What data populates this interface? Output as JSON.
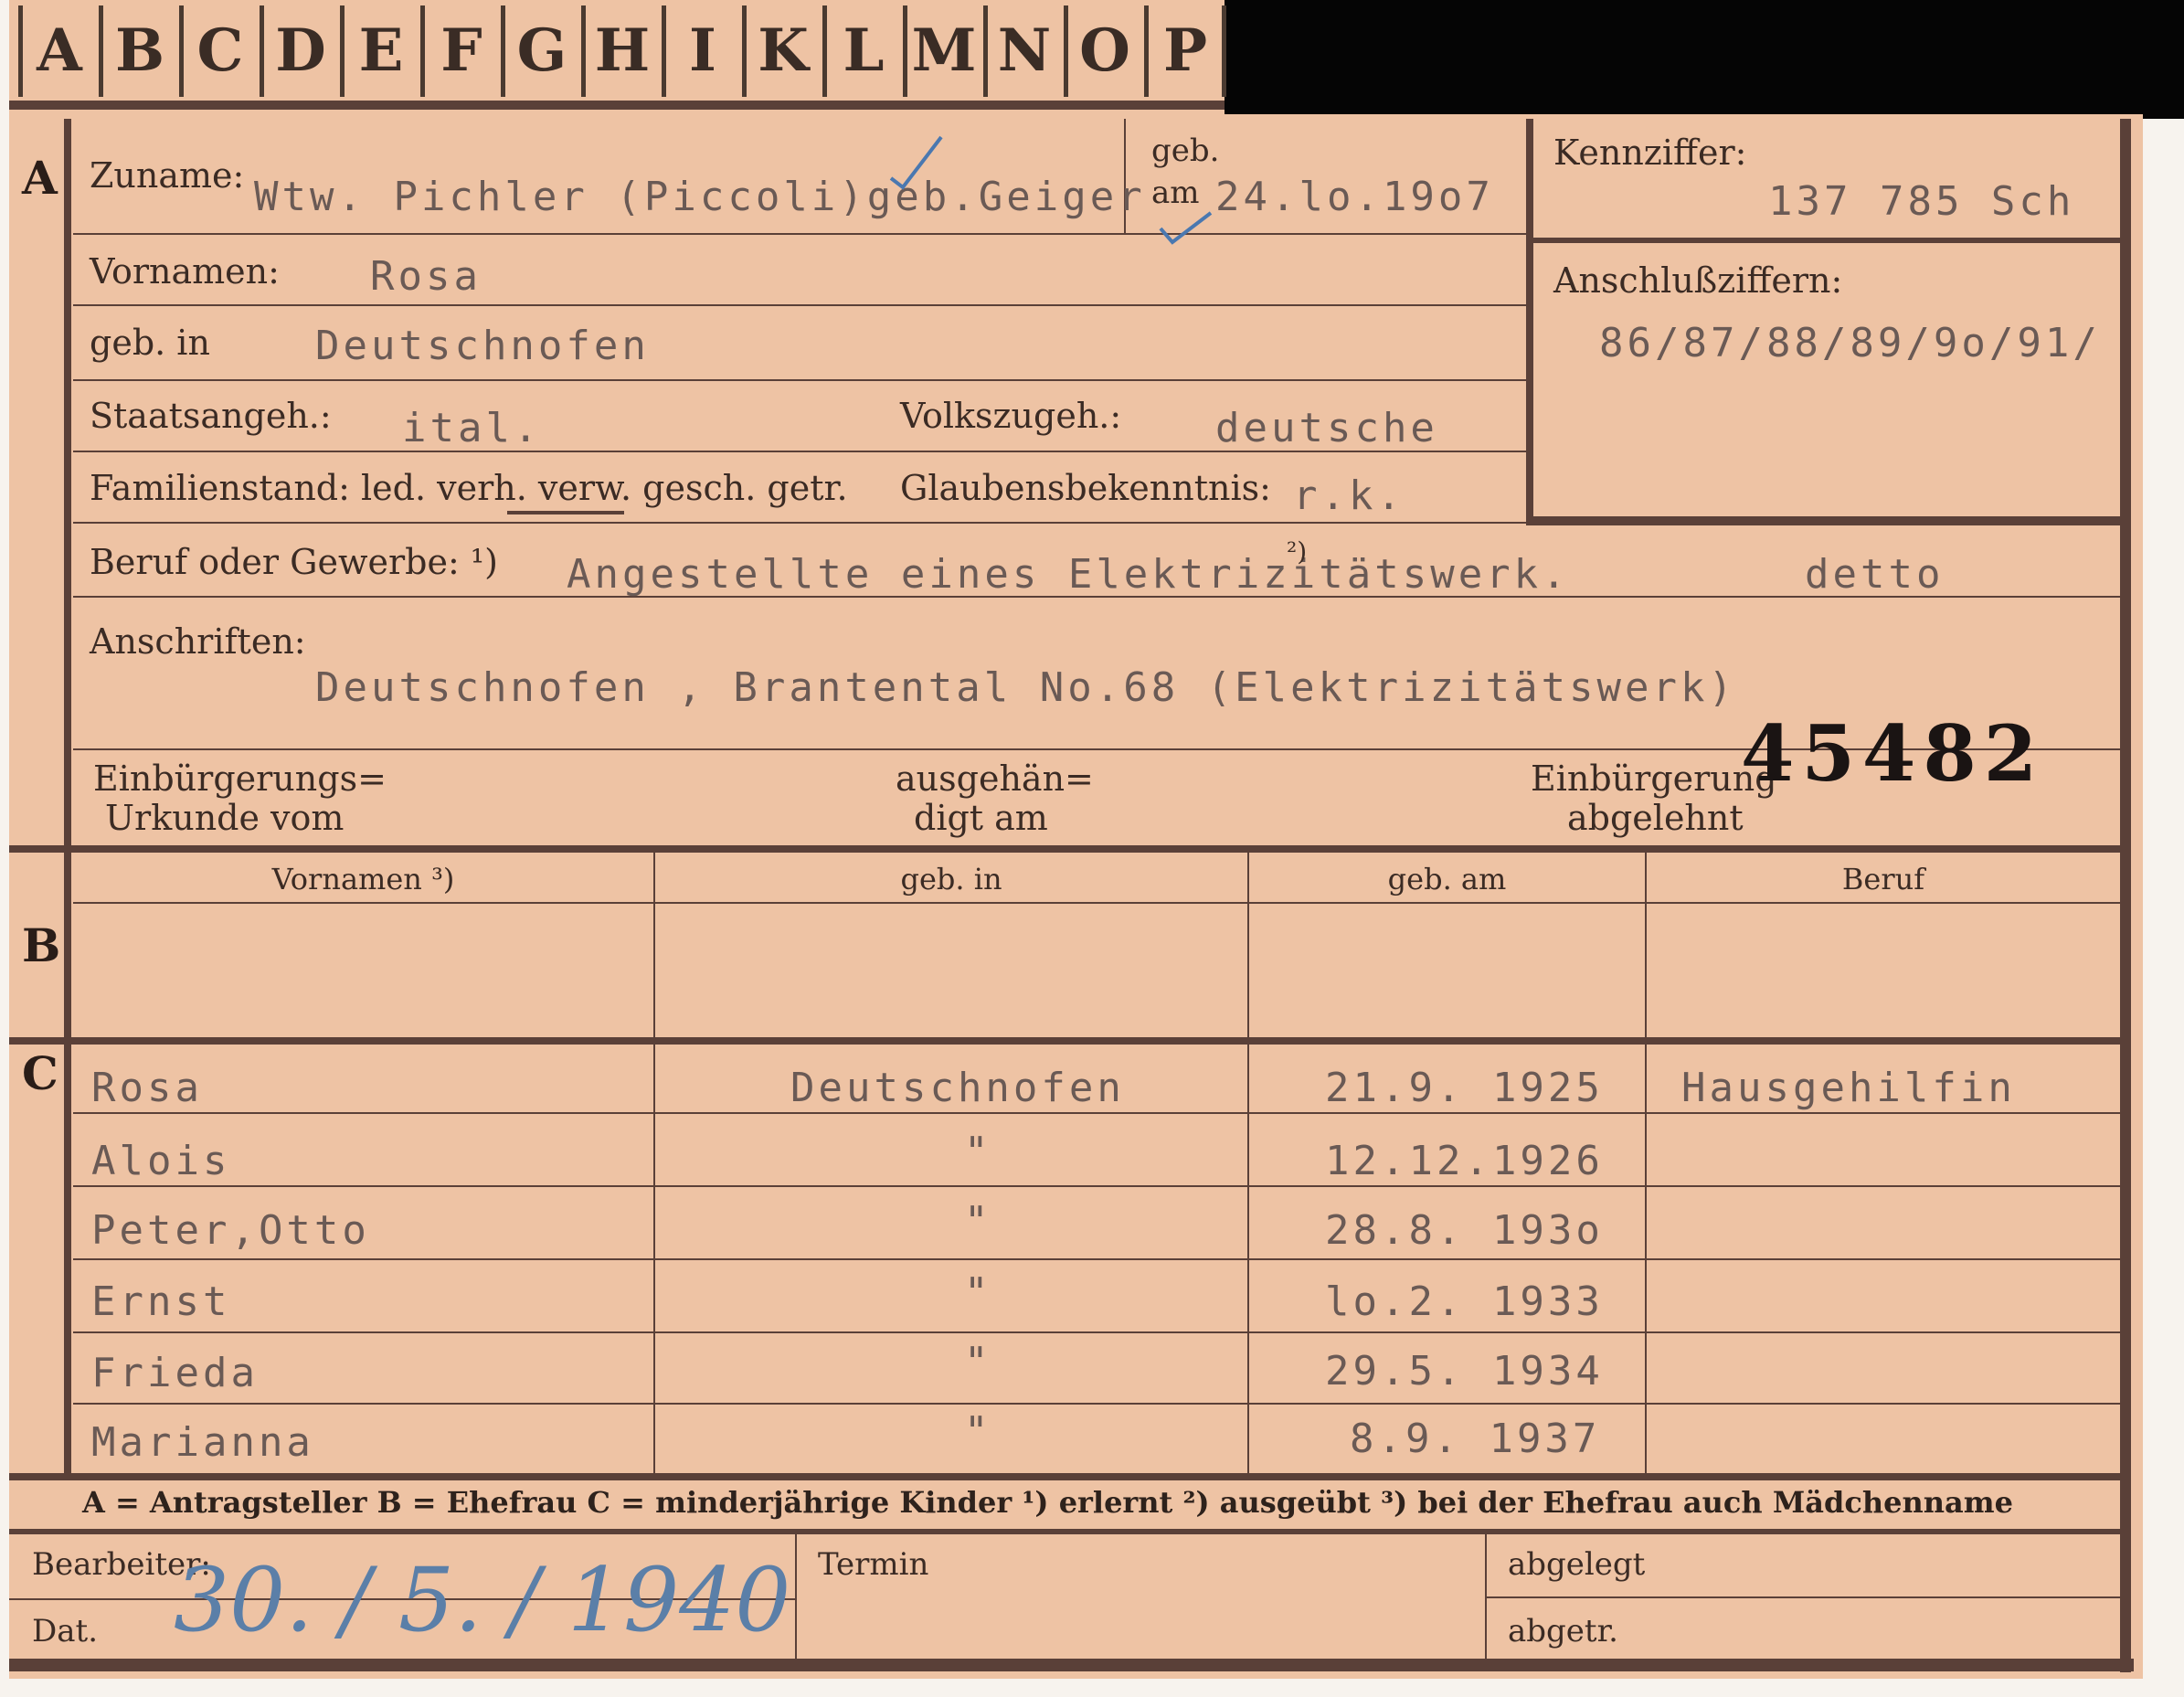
{
  "tabs": [
    "A",
    "B",
    "C",
    "D",
    "E",
    "F",
    "G",
    "H",
    "I",
    "K",
    "L",
    "M",
    "N",
    "O",
    "P"
  ],
  "section_letters": {
    "a": "A",
    "b": "B",
    "c": "C"
  },
  "fields": {
    "zuname_label": "Zuname:",
    "zuname_value": "Wtw. Pichler (Piccoli)geb.Geiger",
    "geb_am_label_1": "geb.",
    "geb_am_label_2": "am",
    "geb_am_value": "24.lo.19o7",
    "vornamen_label": "Vornamen:",
    "vornamen_value": "Rosa",
    "geb_in_label": "geb. in",
    "geb_in_value": "Deutschnofen",
    "staatsangeh_label": "Staatsangeh.:",
    "staatsangeh_value": "ital.",
    "volkszugeh_label": "Volkszugeh.:",
    "volkszugeh_value": "deutsche",
    "familienstand_label": "Familienstand: led. verh. verw. gesch. getr.",
    "glaubens_label": "Glaubensbekenntnis:",
    "glaubens_value": "r.k.",
    "beruf_label": "Beruf oder Gewerbe: ¹)",
    "beruf_value": "Angestellte eines Elektrizitätswerk.",
    "beruf_note": "²)",
    "beruf_value_2": "detto",
    "anschriften_label": "Anschriften:",
    "anschriften_value": "Deutschnofen , Brantental No.68 (Elektrizitätswerk)",
    "einb_urkunde_label_1": "Einbürgerungs=",
    "einb_urkunde_label_2": "Urkunde vom",
    "ausgeh_label_1": "ausgehän=",
    "ausgeh_label_2": "digt am",
    "einb_abgelehnt_label_1": "Einbürgerung",
    "einb_abgelehnt_label_2": "abgelehnt",
    "stamp_number": "45482"
  },
  "right_box": {
    "kennziffer_label": "Kennziffer:",
    "kennziffer_value": "137 785  Sch",
    "anschluss_label": "Anschlußziffern:",
    "anschluss_value": "86/87/88/89/9o/91/"
  },
  "table_b": {
    "headers": [
      "Vornamen ³)",
      "geb. in",
      "geb. am",
      "Beruf"
    ]
  },
  "table_c": {
    "rows": [
      {
        "name": "Rosa",
        "place": "Deutschnofen",
        "date": "21.9. 1925",
        "job": "Hausgehilfin"
      },
      {
        "name": "Alois",
        "place": "\"",
        "date": "12.12.1926",
        "job": ""
      },
      {
        "name": "Peter,Otto",
        "place": "\"",
        "date": "28.8. 193o",
        "job": ""
      },
      {
        "name": "Ernst",
        "place": "\"",
        "date": "lo.2. 1933",
        "job": ""
      },
      {
        "name": "Frieda",
        "place": "\"",
        "date": "29.5. 1934",
        "job": ""
      },
      {
        "name": "Marianna",
        "place": "\"",
        "date": "8.9. 1937",
        "job": ""
      }
    ]
  },
  "legend": "A = Antragsteller   B = Ehefrau   C = minderjährige Kinder   ¹) erlernt   ²) ausgeübt   ³) bei der Ehefrau auch Mädchenname",
  "footer": {
    "bearbeiter_label": "Bearbeiter:",
    "dat_label": "Dat.",
    "dat_value": "30. / 5. / 1940",
    "termin_label": "Termin",
    "abgelegt_label": "abgelegt",
    "abgetr_label": "abgetr."
  },
  "colors": {
    "card": "#eec3a4",
    "ink": "#3b2b24",
    "typewriter": "#6a5a55",
    "handwriting": "#5b7fa8"
  }
}
